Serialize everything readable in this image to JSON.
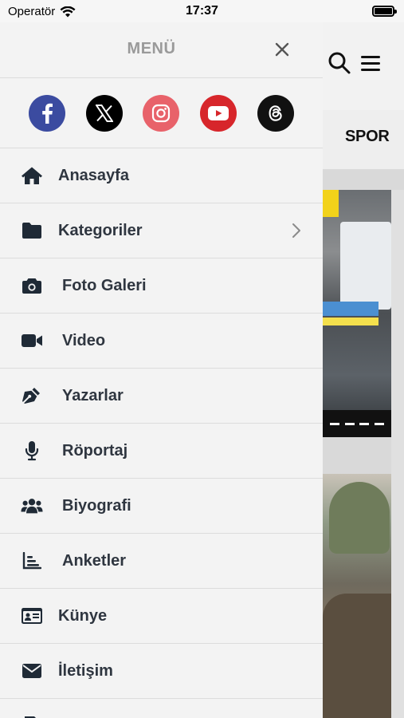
{
  "status_bar": {
    "carrier": "Operatör",
    "time": "17:37"
  },
  "drawer": {
    "title": "MENÜ",
    "social": [
      {
        "name": "facebook",
        "color": "#3b4ba0"
      },
      {
        "name": "x",
        "color": "#000000"
      },
      {
        "name": "instagram",
        "color": "#e8626a"
      },
      {
        "name": "youtube",
        "color": "#d7262b"
      },
      {
        "name": "threads",
        "color": "#111111"
      }
    ],
    "items": [
      {
        "label": "Anasayfa",
        "icon": "home-icon"
      },
      {
        "label": "Kategoriler",
        "icon": "folder-icon",
        "has_submenu": true
      },
      {
        "label": "Foto Galeri",
        "icon": "camera-icon"
      },
      {
        "label": "Video",
        "icon": "video-camera-icon"
      },
      {
        "label": "Yazarlar",
        "icon": "pen-nib-icon"
      },
      {
        "label": "Röportaj",
        "icon": "microphone-icon"
      },
      {
        "label": "Biyografi",
        "icon": "users-icon"
      },
      {
        "label": "Anketler",
        "icon": "bar-chart-icon"
      },
      {
        "label": "Künye",
        "icon": "id-card-icon"
      },
      {
        "label": "İletişim",
        "icon": "envelope-icon"
      },
      {
        "label": "",
        "icon": "file-icon"
      }
    ]
  },
  "background": {
    "tab_label": "SPOR"
  },
  "colors": {
    "text_dark": "#2f3640",
    "icon_dark": "#1f2a36",
    "title_gray": "#9a9a9a"
  }
}
